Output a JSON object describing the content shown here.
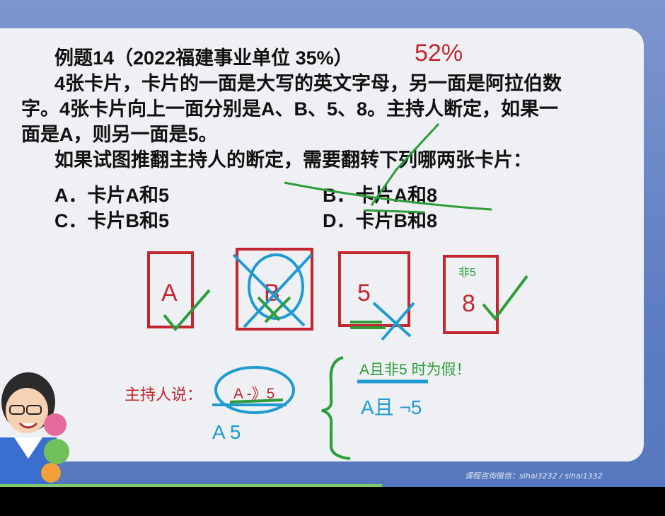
{
  "question": {
    "title": "例题14（2022福建事业单位 35%）",
    "line1": "4张卡片，卡片的一面是大写的英文字母，另一面是阿拉伯数",
    "line2": "字。4张卡片向上一面分别是A、B、5、8。主持人断定，如果一",
    "line3": "面是A，则另一面是5。",
    "line4": "如果试图推翻主持人的断定，需要翻转下列哪两张卡片：",
    "options": {
      "a": "A．卡片A和5",
      "b": "B．卡片A和8",
      "c": "C．卡片B和5",
      "d": "D．卡片B和8"
    }
  },
  "annotations": {
    "percent": "52%",
    "cards": [
      "A",
      "B",
      "5",
      "8"
    ],
    "card4_top": "非5",
    "host_said": "主持人说：",
    "implication": "A -》5",
    "condition": "A且非5 时为假！",
    "handwritten_a5": "A  5",
    "handwritten_neg": "A且 ¬5"
  },
  "footer": {
    "watermark": "课程咨询微信：sihai3232 / sihai1332"
  },
  "colors": {
    "panel": "#eef0f3",
    "red_ink": "#c3262f",
    "green_ink": "#2d9d3a",
    "blue_ink": "#1f9bd1",
    "frame": "#6a86c4"
  }
}
